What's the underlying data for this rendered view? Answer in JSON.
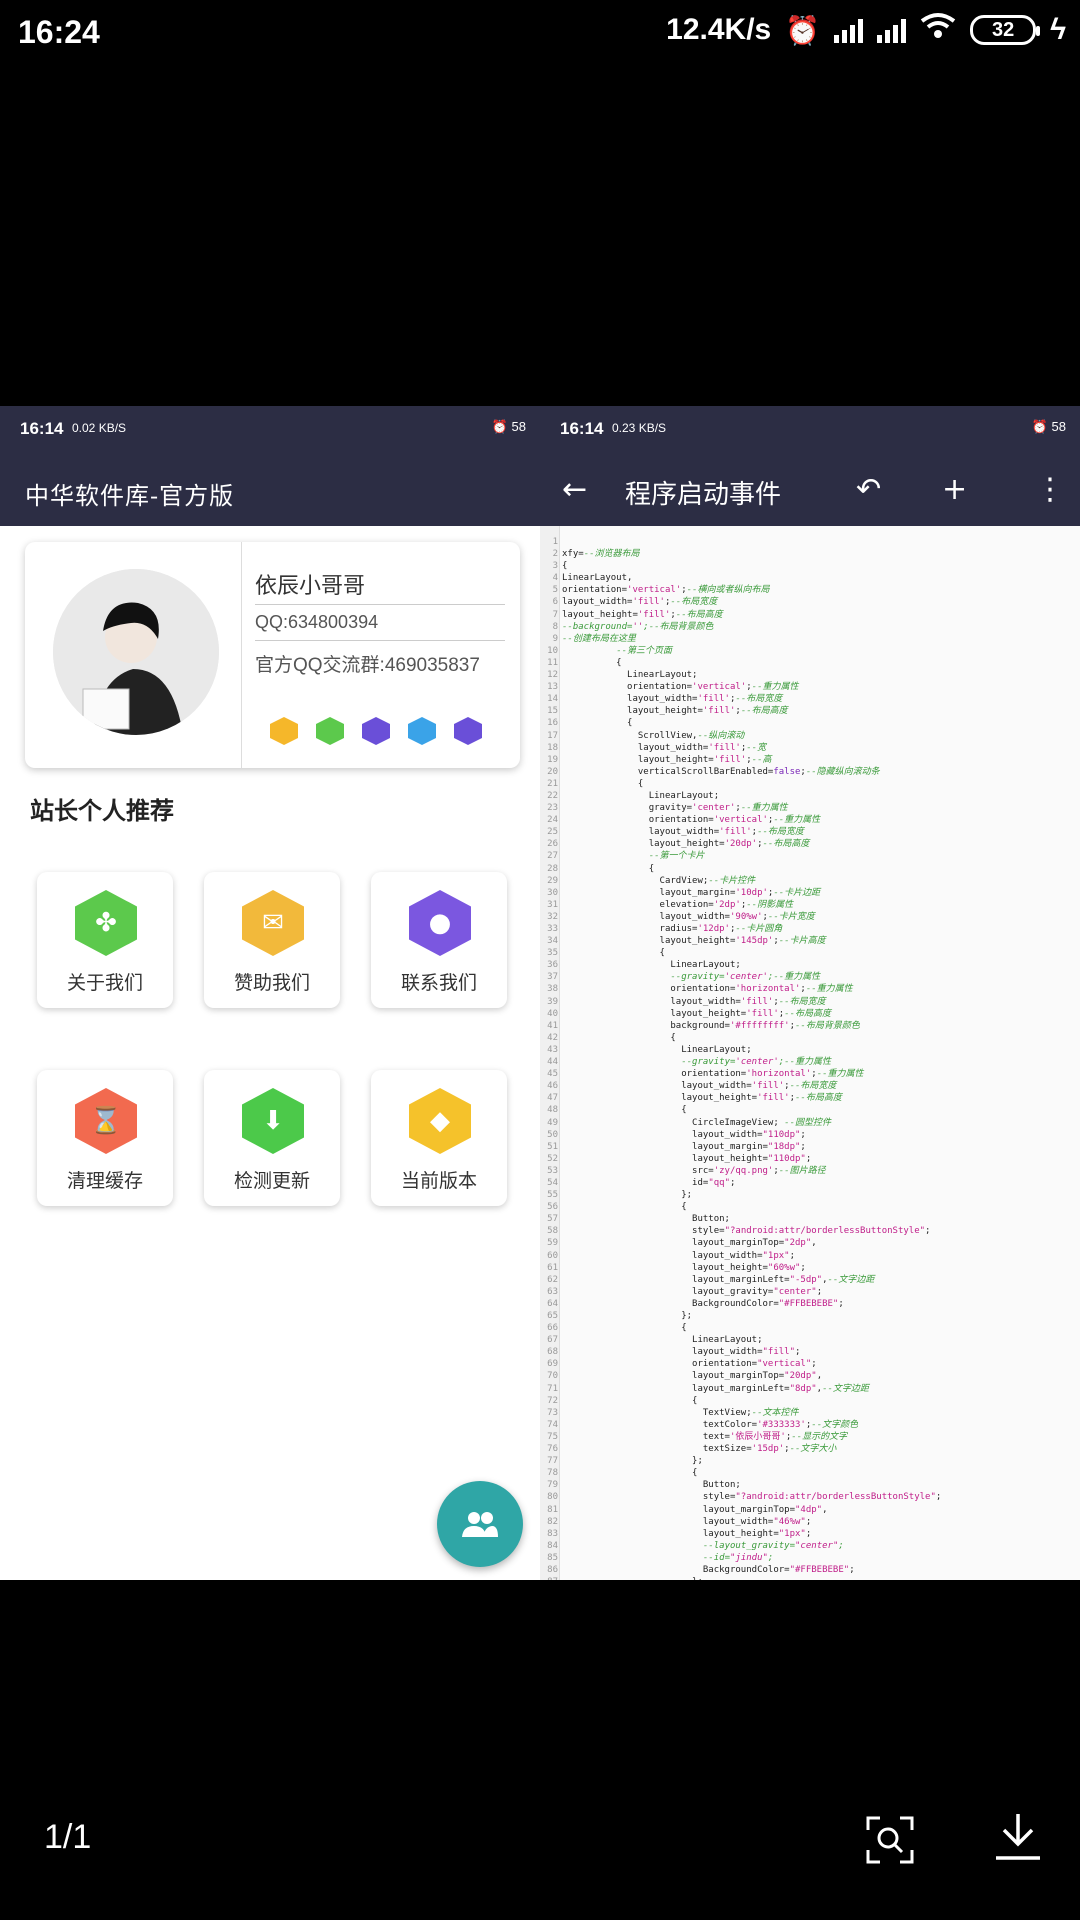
{
  "outer_status": {
    "time": "16:24",
    "net_speed": "12.4K/s",
    "battery": "32"
  },
  "left": {
    "status_time": "16:14",
    "status_net": "0.02 KB/S",
    "status_battery": "58",
    "title": "中华软件库-官方版",
    "profile": {
      "name": "依辰小哥哥",
      "qq": "QQ:634800394",
      "group": "官方QQ交流群:469035837",
      "mini_icon_colors": [
        "#f5b72a",
        "#5cc94c",
        "#6a4fd8",
        "#3aa3e8",
        "#6a4fd8"
      ]
    },
    "section_title": "站长个人推荐",
    "tiles": [
      {
        "label": "关于我们",
        "icon": "clover-icon",
        "color": "#5cc94c"
      },
      {
        "label": "赞助我们",
        "icon": "mail-icon",
        "color": "#f2b93b"
      },
      {
        "label": "联系我们",
        "icon": "person-icon",
        "color": "#7b57e0"
      },
      {
        "label": "清理缓存",
        "icon": "hourglass-icon",
        "color": "#f26a4f"
      },
      {
        "label": "检测更新",
        "icon": "download-icon",
        "color": "#4cc94a"
      },
      {
        "label": "当前版本",
        "icon": "diamond-icon",
        "color": "#f5c22b"
      }
    ]
  },
  "right": {
    "status_time": "16:14",
    "status_net": "0.23 KB/S",
    "status_battery": "58",
    "title": "程序启动事件",
    "code": [
      "",
      "xfy=--浏览器布局",
      "{",
      "LinearLayout,",
      "orientation='vertical';--横向或者纵向布局",
      "layout_width='fill';--布局宽度",
      "layout_height='fill';--布局高度",
      "--background='';--布局背景颜色",
      "--创建布局在这里",
      "          --第三个页面",
      "          {",
      "            LinearLayout;",
      "            orientation='vertical';--重力属性",
      "            layout_width='fill';--布局宽度",
      "            layout_height='fill';--布局高度",
      "            {",
      "              ScrollView,--纵向滚动",
      "              layout_width='fill';--宽",
      "              layout_height='fill';--高",
      "              verticalScrollBarEnabled=false;--隐藏纵向滚动条",
      "              {",
      "                LinearLayout;",
      "                gravity='center';--重力属性",
      "                orientation='vertical';--重力属性",
      "                layout_width='fill';--布局宽度",
      "                layout_height='20dp';--布局高度",
      "                --第一个卡片",
      "                {",
      "                  CardView;--卡片控件",
      "                  layout_margin='10dp';--卡片边距",
      "                  elevation='2dp';--阴影属性",
      "                  layout_width='90%w';--卡片宽度",
      "                  radius='12dp';--卡片圆角",
      "                  layout_height='145dp';--卡片高度",
      "                  {",
      "                    LinearLayout;",
      "                    --gravity='center';--重力属性",
      "                    orientation='horizontal';--重力属性",
      "                    layout_width='fill';--布局宽度",
      "                    layout_height='fill';--布局高度",
      "                    background='#ffffffff';--布局背景颜色",
      "                    {",
      "                      LinearLayout;",
      "                      --gravity='center';--重力属性",
      "                      orientation='horizontal';--重力属性",
      "                      layout_width='fill';--布局宽度",
      "                      layout_height='fill';--布局高度",
      "                      {",
      "                        CircleImageView; --圆型控件",
      "                        layout_width=\"110dp\";",
      "                        layout_margin=\"18dp\";",
      "                        layout_height=\"110dp\";",
      "                        src='zy/qq.png';--图片路径",
      "                        id=\"qq\";",
      "                      };",
      "                      {",
      "                        Button;",
      "                        style=\"?android:attr/borderlessButtonStyle\";",
      "                        layout_marginTop=\"2dp\",",
      "                        layout_width=\"1px\";",
      "                        layout_height=\"60%w\";",
      "                        layout_marginLeft=\"-5dp\",--文字边距",
      "                        layout_gravity=\"center\";",
      "                        BackgroundColor=\"#FFBEBEBE\";",
      "                      };",
      "                      {",
      "                        LinearLayout;",
      "                        layout_width=\"fill\";",
      "                        orientation=\"vertical\";",
      "                        layout_marginTop=\"20dp\",",
      "                        layout_marginLeft=\"8dp\",--文字边距",
      "                        {",
      "                          TextView;--文本控件",
      "                          textColor='#333333';--文字颜色",
      "                          text='依辰小哥哥';--显示的文字",
      "                          textSize='15dp';--文字大小",
      "                        };",
      "                        {",
      "                          Button;",
      "                          style=\"?android:attr/borderlessButtonStyle\";",
      "                          layout_marginTop=\"4dp\",",
      "                          layout_width=\"46%w\";",
      "                          layout_height=\"1px\";",
      "                          --layout_gravity=\"center\";",
      "                          --id=\"jindu\";",
      "                          BackgroundColor=\"#FFBEBEBE\";",
      "                        };"
    ]
  },
  "viewer": {
    "page_counter": "1/1"
  },
  "colors": {
    "toolbar": "#2c2d44",
    "fab": "#2fa6a6"
  }
}
